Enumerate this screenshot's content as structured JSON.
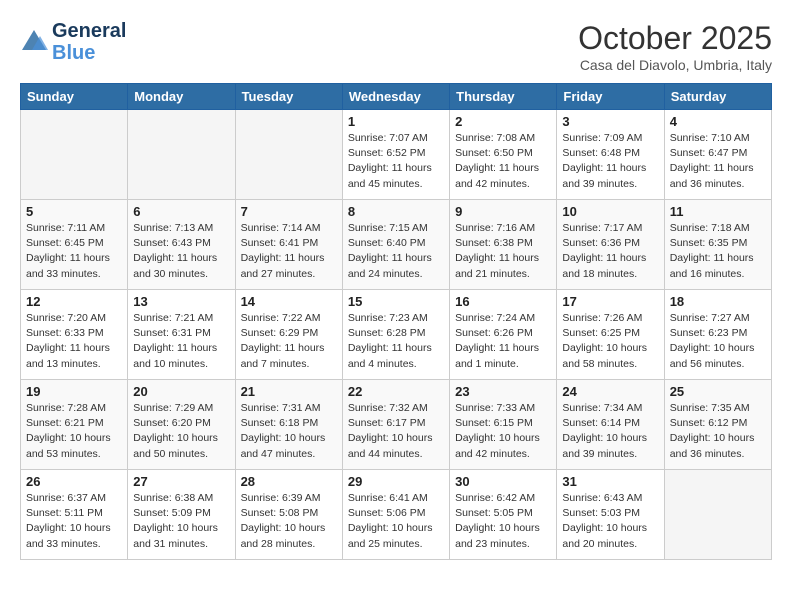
{
  "logo": {
    "line1": "General",
    "line2": "Blue"
  },
  "title": "October 2025",
  "subtitle": "Casa del Diavolo, Umbria, Italy",
  "days_of_week": [
    "Sunday",
    "Monday",
    "Tuesday",
    "Wednesday",
    "Thursday",
    "Friday",
    "Saturday"
  ],
  "weeks": [
    [
      {
        "day": "",
        "info": ""
      },
      {
        "day": "",
        "info": ""
      },
      {
        "day": "",
        "info": ""
      },
      {
        "day": "1",
        "info": "Sunrise: 7:07 AM\nSunset: 6:52 PM\nDaylight: 11 hours\nand 45 minutes."
      },
      {
        "day": "2",
        "info": "Sunrise: 7:08 AM\nSunset: 6:50 PM\nDaylight: 11 hours\nand 42 minutes."
      },
      {
        "day": "3",
        "info": "Sunrise: 7:09 AM\nSunset: 6:48 PM\nDaylight: 11 hours\nand 39 minutes."
      },
      {
        "day": "4",
        "info": "Sunrise: 7:10 AM\nSunset: 6:47 PM\nDaylight: 11 hours\nand 36 minutes."
      }
    ],
    [
      {
        "day": "5",
        "info": "Sunrise: 7:11 AM\nSunset: 6:45 PM\nDaylight: 11 hours\nand 33 minutes."
      },
      {
        "day": "6",
        "info": "Sunrise: 7:13 AM\nSunset: 6:43 PM\nDaylight: 11 hours\nand 30 minutes."
      },
      {
        "day": "7",
        "info": "Sunrise: 7:14 AM\nSunset: 6:41 PM\nDaylight: 11 hours\nand 27 minutes."
      },
      {
        "day": "8",
        "info": "Sunrise: 7:15 AM\nSunset: 6:40 PM\nDaylight: 11 hours\nand 24 minutes."
      },
      {
        "day": "9",
        "info": "Sunrise: 7:16 AM\nSunset: 6:38 PM\nDaylight: 11 hours\nand 21 minutes."
      },
      {
        "day": "10",
        "info": "Sunrise: 7:17 AM\nSunset: 6:36 PM\nDaylight: 11 hours\nand 18 minutes."
      },
      {
        "day": "11",
        "info": "Sunrise: 7:18 AM\nSunset: 6:35 PM\nDaylight: 11 hours\nand 16 minutes."
      }
    ],
    [
      {
        "day": "12",
        "info": "Sunrise: 7:20 AM\nSunset: 6:33 PM\nDaylight: 11 hours\nand 13 minutes."
      },
      {
        "day": "13",
        "info": "Sunrise: 7:21 AM\nSunset: 6:31 PM\nDaylight: 11 hours\nand 10 minutes."
      },
      {
        "day": "14",
        "info": "Sunrise: 7:22 AM\nSunset: 6:29 PM\nDaylight: 11 hours\nand 7 minutes."
      },
      {
        "day": "15",
        "info": "Sunrise: 7:23 AM\nSunset: 6:28 PM\nDaylight: 11 hours\nand 4 minutes."
      },
      {
        "day": "16",
        "info": "Sunrise: 7:24 AM\nSunset: 6:26 PM\nDaylight: 11 hours\nand 1 minute."
      },
      {
        "day": "17",
        "info": "Sunrise: 7:26 AM\nSunset: 6:25 PM\nDaylight: 10 hours\nand 58 minutes."
      },
      {
        "day": "18",
        "info": "Sunrise: 7:27 AM\nSunset: 6:23 PM\nDaylight: 10 hours\nand 56 minutes."
      }
    ],
    [
      {
        "day": "19",
        "info": "Sunrise: 7:28 AM\nSunset: 6:21 PM\nDaylight: 10 hours\nand 53 minutes."
      },
      {
        "day": "20",
        "info": "Sunrise: 7:29 AM\nSunset: 6:20 PM\nDaylight: 10 hours\nand 50 minutes."
      },
      {
        "day": "21",
        "info": "Sunrise: 7:31 AM\nSunset: 6:18 PM\nDaylight: 10 hours\nand 47 minutes."
      },
      {
        "day": "22",
        "info": "Sunrise: 7:32 AM\nSunset: 6:17 PM\nDaylight: 10 hours\nand 44 minutes."
      },
      {
        "day": "23",
        "info": "Sunrise: 7:33 AM\nSunset: 6:15 PM\nDaylight: 10 hours\nand 42 minutes."
      },
      {
        "day": "24",
        "info": "Sunrise: 7:34 AM\nSunset: 6:14 PM\nDaylight: 10 hours\nand 39 minutes."
      },
      {
        "day": "25",
        "info": "Sunrise: 7:35 AM\nSunset: 6:12 PM\nDaylight: 10 hours\nand 36 minutes."
      }
    ],
    [
      {
        "day": "26",
        "info": "Sunrise: 6:37 AM\nSunset: 5:11 PM\nDaylight: 10 hours\nand 33 minutes."
      },
      {
        "day": "27",
        "info": "Sunrise: 6:38 AM\nSunset: 5:09 PM\nDaylight: 10 hours\nand 31 minutes."
      },
      {
        "day": "28",
        "info": "Sunrise: 6:39 AM\nSunset: 5:08 PM\nDaylight: 10 hours\nand 28 minutes."
      },
      {
        "day": "29",
        "info": "Sunrise: 6:41 AM\nSunset: 5:06 PM\nDaylight: 10 hours\nand 25 minutes."
      },
      {
        "day": "30",
        "info": "Sunrise: 6:42 AM\nSunset: 5:05 PM\nDaylight: 10 hours\nand 23 minutes."
      },
      {
        "day": "31",
        "info": "Sunrise: 6:43 AM\nSunset: 5:03 PM\nDaylight: 10 hours\nand 20 minutes."
      },
      {
        "day": "",
        "info": ""
      }
    ]
  ]
}
